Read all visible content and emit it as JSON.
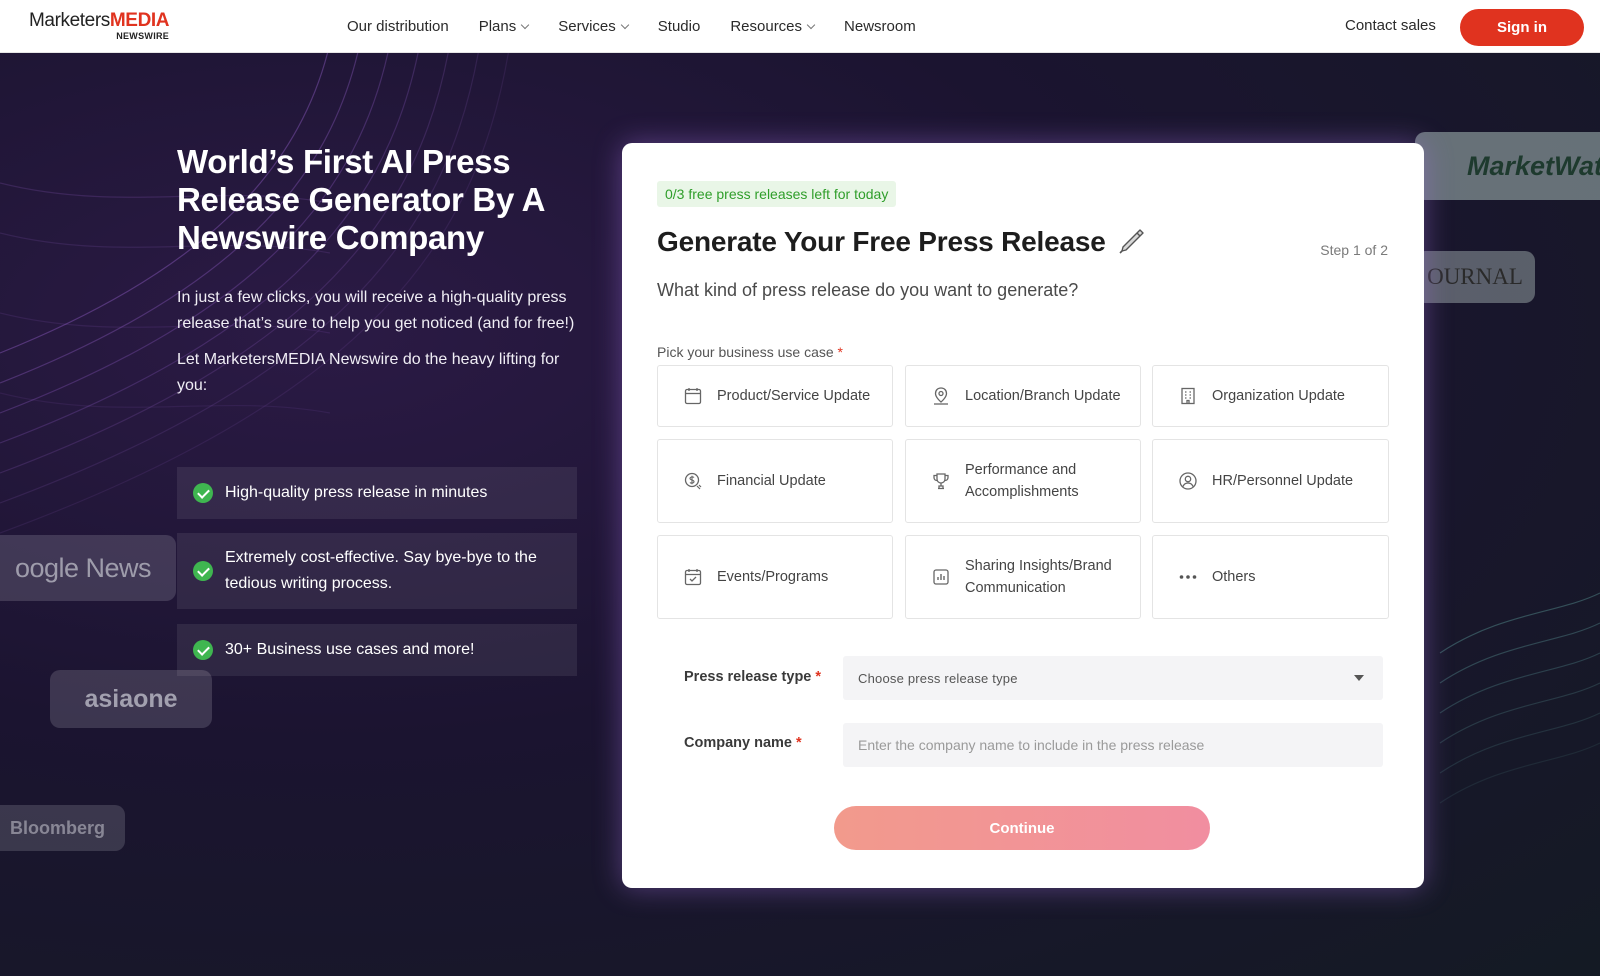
{
  "header": {
    "logo_main": "Marketers",
    "logo_accent": "MEDIA",
    "logo_sub": "NEWSWIRE",
    "nav": [
      {
        "label": "Our distribution",
        "dropdown": false
      },
      {
        "label": "Plans",
        "dropdown": true
      },
      {
        "label": "Services",
        "dropdown": true
      },
      {
        "label": "Studio",
        "dropdown": false
      },
      {
        "label": "Resources",
        "dropdown": true
      },
      {
        "label": "Newsroom",
        "dropdown": false
      }
    ],
    "contact_sales": "Contact sales",
    "sign_in": "Sign in"
  },
  "hero": {
    "title": "World’s First AI Press Release Generator By A Newswire Company",
    "description": "In just a few clicks, you will receive a high-quality press release that’s sure to help you get noticed (and for free!)",
    "description2": "Let MarketersMEDIA Newswire do the heavy lifting for you:",
    "features": [
      "High-quality press release in minutes",
      "Extremely cost-effective. Say bye-bye to the tedious writing process.",
      "30+ Business use cases and more!"
    ]
  },
  "media_logos": {
    "google": "oogle News",
    "asiaone": "asiaone",
    "bloomberg": "Bloomberg",
    "marketwatch": "MarketWat",
    "journal": "OURNAL"
  },
  "card": {
    "badge": "0/3 free press releases left for today",
    "title": "Generate Your Free Press Release",
    "step": "Step 1 of 2",
    "subtitle": "What kind of press release do you want to generate?",
    "use_case_label": "Pick your business use case",
    "required_mark": "*",
    "use_cases": [
      {
        "label": "Product/Service Update",
        "icon": "calendar-box-icon"
      },
      {
        "label": "Location/Branch Update",
        "icon": "location-pin-icon"
      },
      {
        "label": "Organization Update",
        "icon": "building-icon"
      },
      {
        "label": "Financial Update",
        "icon": "dollar-coin-icon"
      },
      {
        "label": "Performance and Accomplishments",
        "icon": "trophy-icon"
      },
      {
        "label": "HR/Personnel Update",
        "icon": "person-circle-icon"
      },
      {
        "label": "Events/Programs",
        "icon": "calendar-check-icon"
      },
      {
        "label": "Sharing Insights/Brand Communication",
        "icon": "chart-box-icon"
      },
      {
        "label": "Others",
        "icon": "more-dots-icon"
      }
    ],
    "press_type_label": "Press release type",
    "press_type_value": "Choose press release type",
    "company_label": "Company name",
    "company_placeholder": "Enter the company name to include in the press release",
    "continue_label": "Continue"
  },
  "colors": {
    "brand_red": "#e0331f",
    "badge_green": "#2f9e2a",
    "check_green": "#3fb650"
  }
}
